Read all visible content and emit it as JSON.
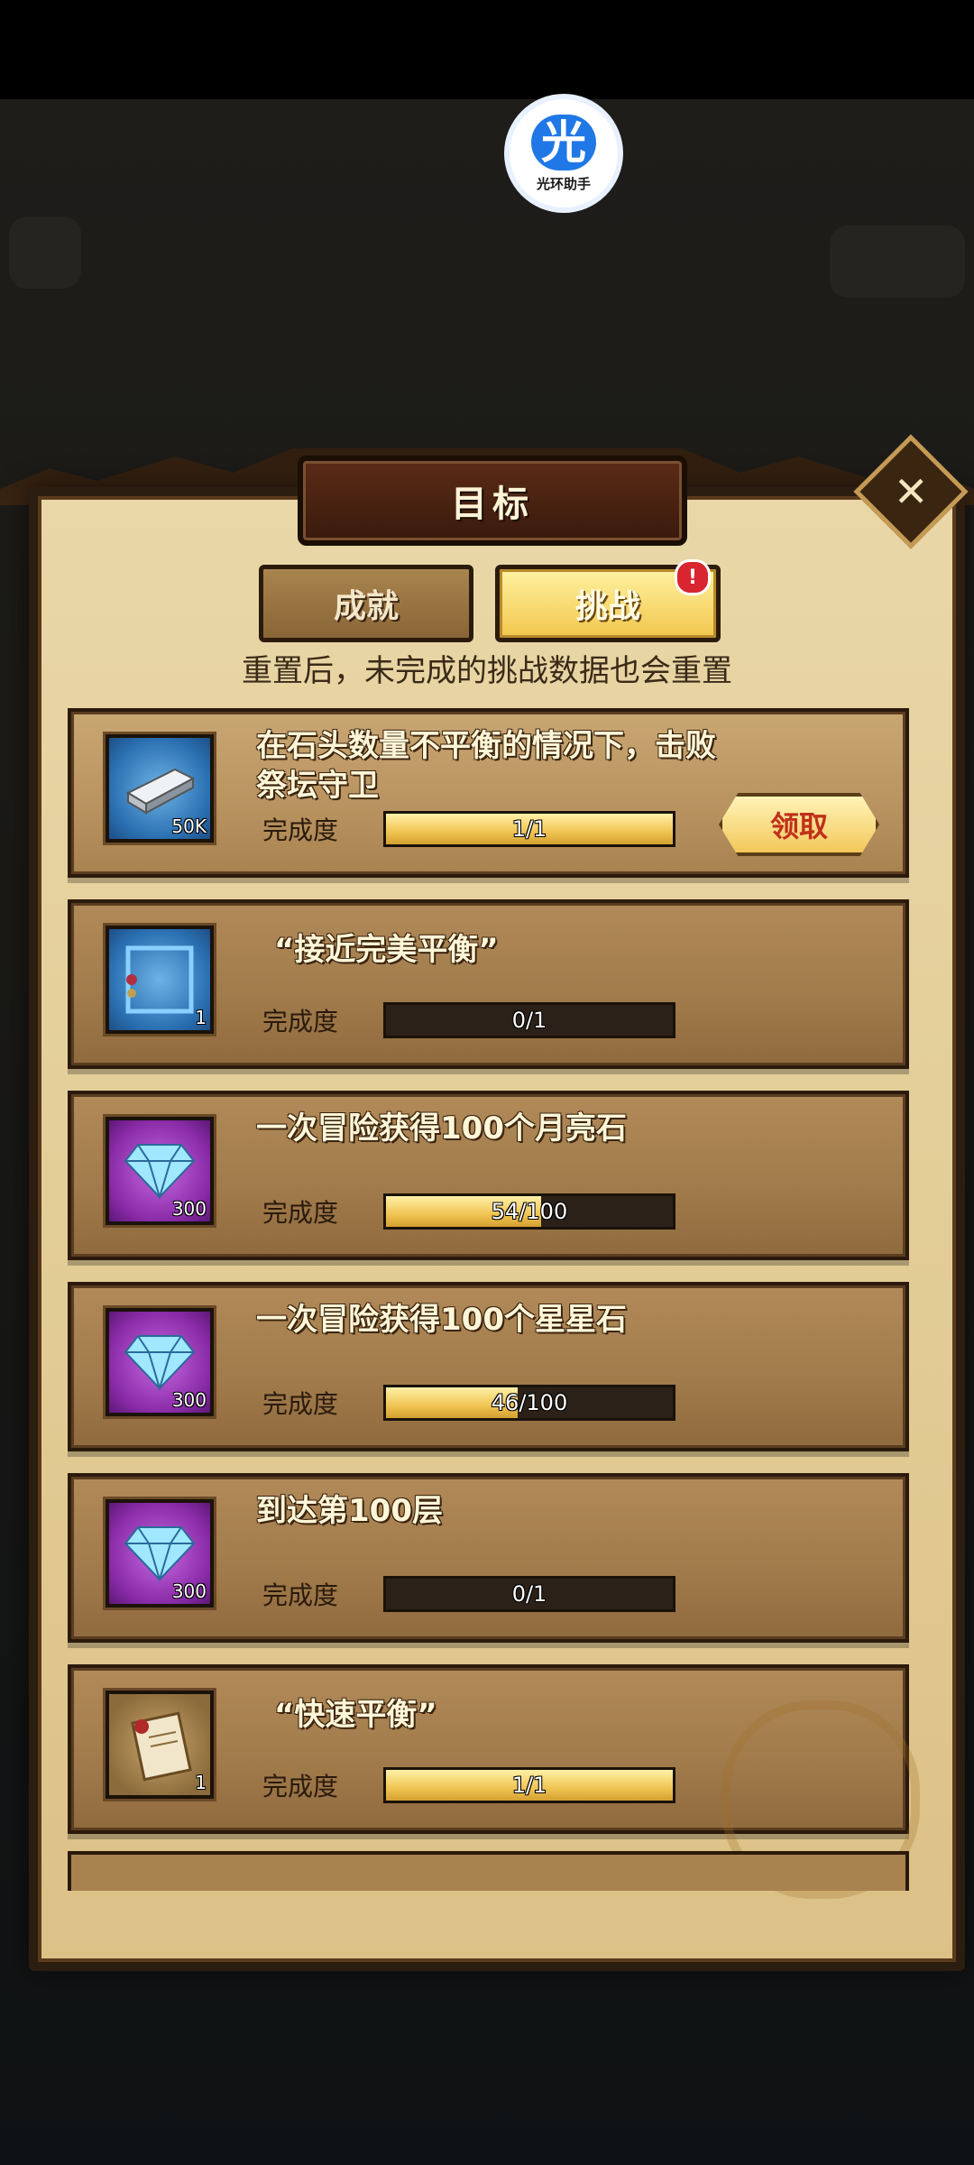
{
  "helper": {
    "glyph": "光",
    "caption": "光环助手"
  },
  "dialog": {
    "title": "目标",
    "close_glyph": "✕"
  },
  "tabs": [
    {
      "label": "成就",
      "active": false
    },
    {
      "label": "挑战",
      "active": true,
      "badge": "!"
    }
  ],
  "notice": "重置后，未完成的挑战数据也会重置",
  "progress_label": "完成度",
  "claim_label": "领取",
  "challenges": [
    {
      "title": "在石头数量不平衡的情况下，击败祭坛守卫",
      "icon": "silver-ingot-icon",
      "qty": "50K",
      "progress_text": "1/1",
      "progress": 1.0
    },
    {
      "title": "“接近完美平衡”",
      "icon": "frame-icon",
      "qty": "1",
      "progress_text": "0/1",
      "progress": 0.0
    },
    {
      "title": "一次冒险获得100个月亮石",
      "icon": "diamond-icon",
      "qty": "300",
      "progress_text": "54/100",
      "progress": 0.54
    },
    {
      "title": "一次冒险获得100个星星石",
      "icon": "diamond-icon",
      "qty": "300",
      "progress_text": "46/100",
      "progress": 0.46
    },
    {
      "title": "到达第100层",
      "icon": "diamond-icon",
      "qty": "300",
      "progress_text": "0/1",
      "progress": 0.0
    },
    {
      "title": "“快速平衡”",
      "icon": "scroll-icon",
      "qty": "1",
      "progress_text": "1/1",
      "progress": 1.0
    }
  ]
}
